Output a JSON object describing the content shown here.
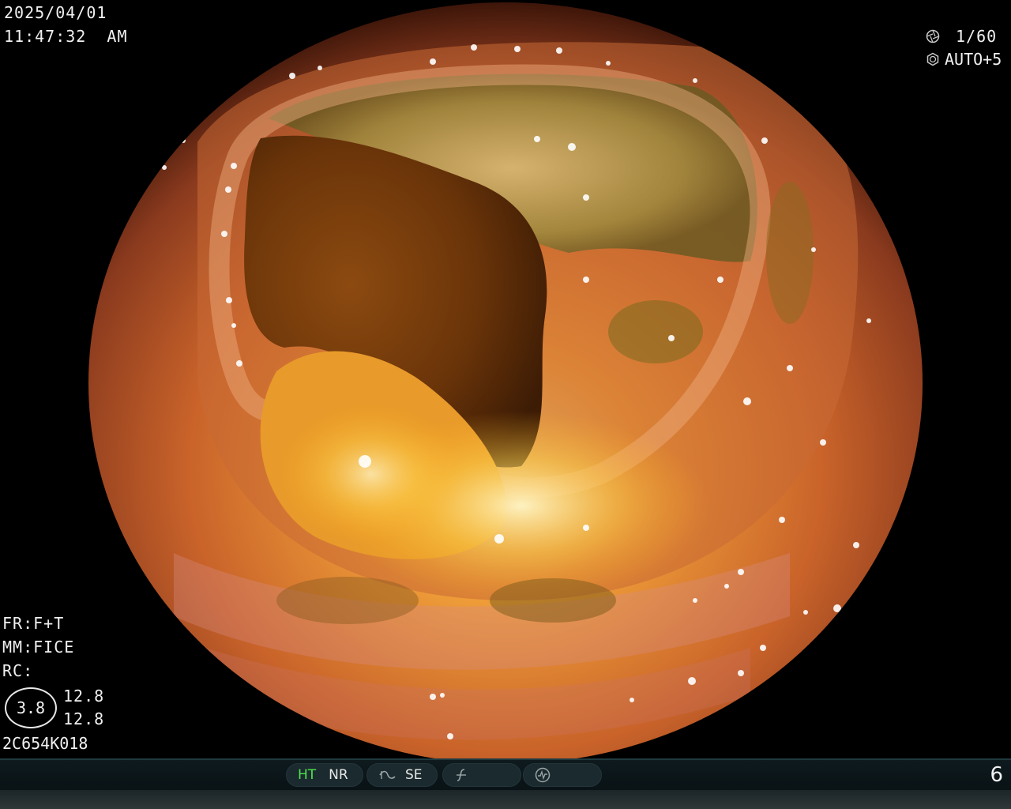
{
  "overlay": {
    "date": "2025/04/01",
    "time": "11:47:32  AM",
    "shutter_icon": "shutter-icon",
    "shutter": "1/60",
    "iris_icon": "iris-icon",
    "iris": "AUTO+5",
    "fr": "FR:F+T",
    "mm": "MM:FICE",
    "rc": "RC:",
    "level": "3.8",
    "val_a": "12.8",
    "val_b": "12.8",
    "scope_id": "2C654K018"
  },
  "status_bar": {
    "ht": "HT",
    "nr": "NR",
    "curve_icon": "curve-icon",
    "se": "SE",
    "slash_icon": "slash-f-icon",
    "gauge_icon": "gauge-icon",
    "page_number": "6"
  },
  "colors": {
    "ht_active": "#4fe34f",
    "background": "#000000",
    "status_bar": "#0e1a1e"
  }
}
